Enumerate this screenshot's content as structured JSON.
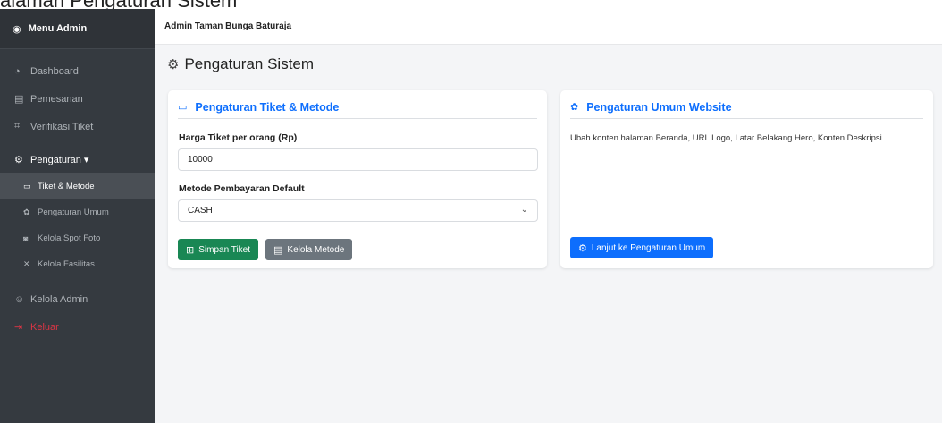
{
  "caption": "alaman Pengaturan Sistem",
  "sidebar": {
    "title": "Menu Admin",
    "title_icon": "circle-dot-icon",
    "items": [
      {
        "label": "Dashboard",
        "icon": "speedometer-icon"
      },
      {
        "label": "Pemesanan",
        "icon": "list-icon"
      },
      {
        "label": "Verifikasi Tiket",
        "icon": "qr-icon"
      }
    ],
    "settings": {
      "label": "Pengaturan ▾",
      "icon": "gear-icon"
    },
    "sub_items": [
      {
        "label": "Tiket & Metode",
        "icon": "ticket-icon",
        "active": true
      },
      {
        "label": "Pengaturan Umum",
        "icon": "palette-icon"
      },
      {
        "label": "Kelola Spot Foto",
        "icon": "camera-icon"
      },
      {
        "label": "Kelola Fasilitas",
        "icon": "tools-icon"
      }
    ],
    "admin": {
      "label": "Kelola Admin",
      "icon": "people-icon"
    },
    "logout": {
      "label": "Keluar",
      "icon": "logout-icon",
      "color": "#dc3545"
    }
  },
  "topbar": {
    "title": "Admin Taman Bunga Baturaja"
  },
  "page": {
    "title": "Pengaturan Sistem"
  },
  "ticket_card": {
    "title": "Pengaturan Tiket & Metode",
    "price_label": "Harga Tiket per orang (Rp)",
    "price_value": "10000",
    "method_label": "Metode Pembayaran Default",
    "method_value": "CASH",
    "save_label": "Simpan Tiket",
    "manage_label": "Kelola Metode"
  },
  "general_card": {
    "title": "Pengaturan Umum Website",
    "description": "Ubah konten halaman Beranda, URL Logo, Latar Belakang Hero, Konten Deskripsi.",
    "button_label": "Lanjut ke Pengaturan Umum"
  },
  "colors": {
    "primary": "#0d6efd",
    "success": "#198754",
    "secondary": "#6c757d",
    "danger": "#dc3545",
    "sidebar": "#353a40"
  }
}
